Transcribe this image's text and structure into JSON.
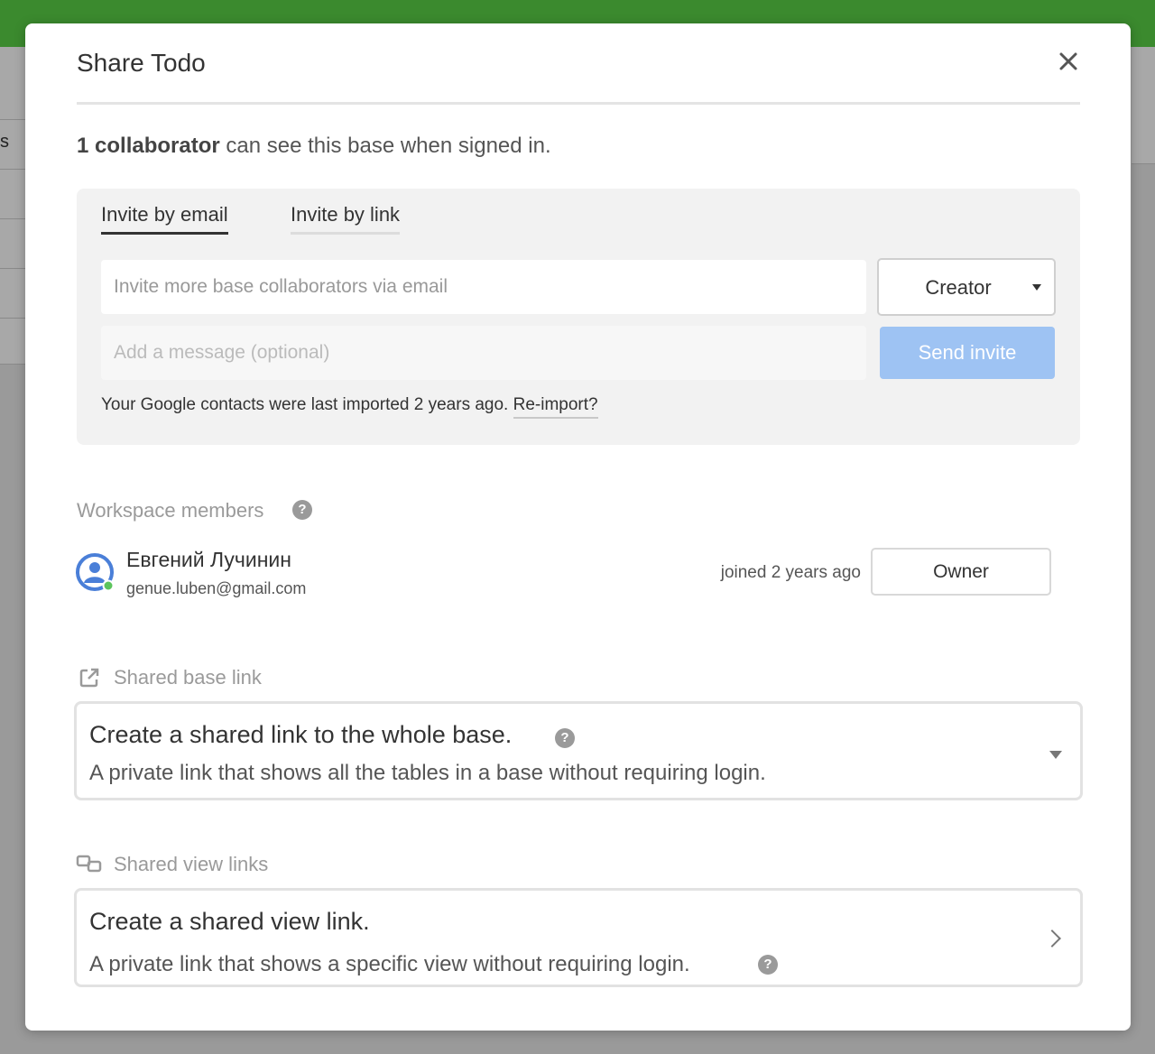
{
  "background": {
    "left_fragment": "s"
  },
  "modal": {
    "title": "Share Todo",
    "summary_bold": "1 collaborator",
    "summary_rest": " can see this base when signed in."
  },
  "invite": {
    "tabs": [
      {
        "label": "Invite by email",
        "active": true
      },
      {
        "label": "Invite by link",
        "active": false
      }
    ],
    "email_placeholder": "Invite more base collaborators via email",
    "message_placeholder": "Add a message (optional)",
    "role": "Creator",
    "send_label": "Send invite",
    "contacts_note": "Your Google contacts were last imported 2 years ago.",
    "reimport_label": "Re-import?"
  },
  "workspace": {
    "label": "Workspace members",
    "members": [
      {
        "name": "Евгений Лучинин",
        "email": "genue.luben@gmail.com",
        "joined": "joined 2 years ago",
        "role": "Owner",
        "online": true
      }
    ]
  },
  "shared_base": {
    "label": "Shared base link",
    "title": "Create a shared link to the whole base.",
    "description": "A private link that shows all the tables in a base without requiring login."
  },
  "shared_views": {
    "label": "Shared view links",
    "title": "Create a shared view link.",
    "description": "A private link that shows a specific view without requiring login."
  },
  "colors": {
    "header_green": "#3b8a2e",
    "send_button": "#9ec3f3",
    "avatar_blue": "#4a7fd8",
    "online_green": "#5cc45c"
  }
}
